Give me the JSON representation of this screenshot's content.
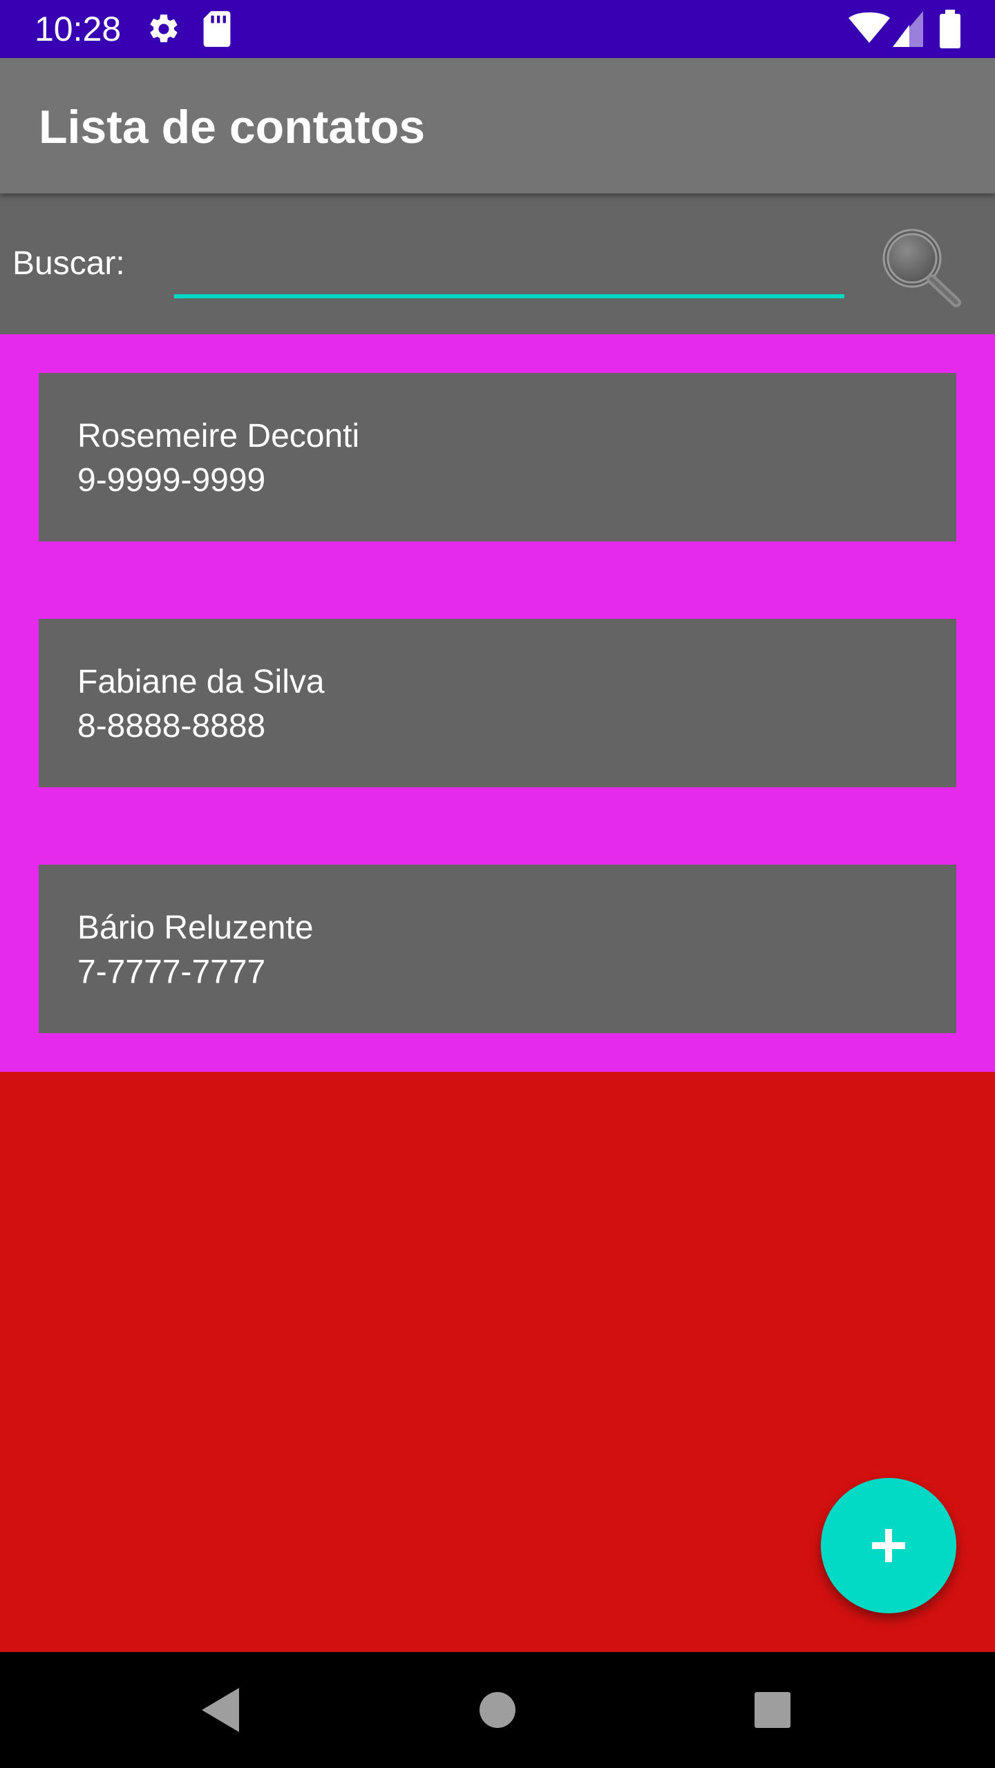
{
  "status_bar": {
    "time": "10:28",
    "icons": [
      "settings-icon",
      "sd-card-icon",
      "wifi-icon",
      "signal-icon",
      "battery-icon"
    ],
    "background": "#3700b3"
  },
  "app_bar": {
    "title": "Lista de contatos",
    "background": "#747474"
  },
  "search": {
    "label": "Buscar:",
    "value": "",
    "placeholder": "",
    "button_icon": "search-icon",
    "accent": "#03dac5"
  },
  "contacts": [
    {
      "name": "Rosemeire Deconti",
      "phone": "9-9999-9999"
    },
    {
      "name": "Fabiane da Silva",
      "phone": "8-8888-8888"
    },
    {
      "name": "Bário Reluzente",
      "phone": "7-7777-7777"
    }
  ],
  "fab": {
    "icon": "plus-icon",
    "color": "#03dac5"
  },
  "colors": {
    "list_background": "#e52aee",
    "card_background": "#646464",
    "page_background": "#d31010"
  },
  "nav_bar": {
    "icons": [
      "back-icon",
      "home-icon",
      "recents-icon"
    ]
  }
}
